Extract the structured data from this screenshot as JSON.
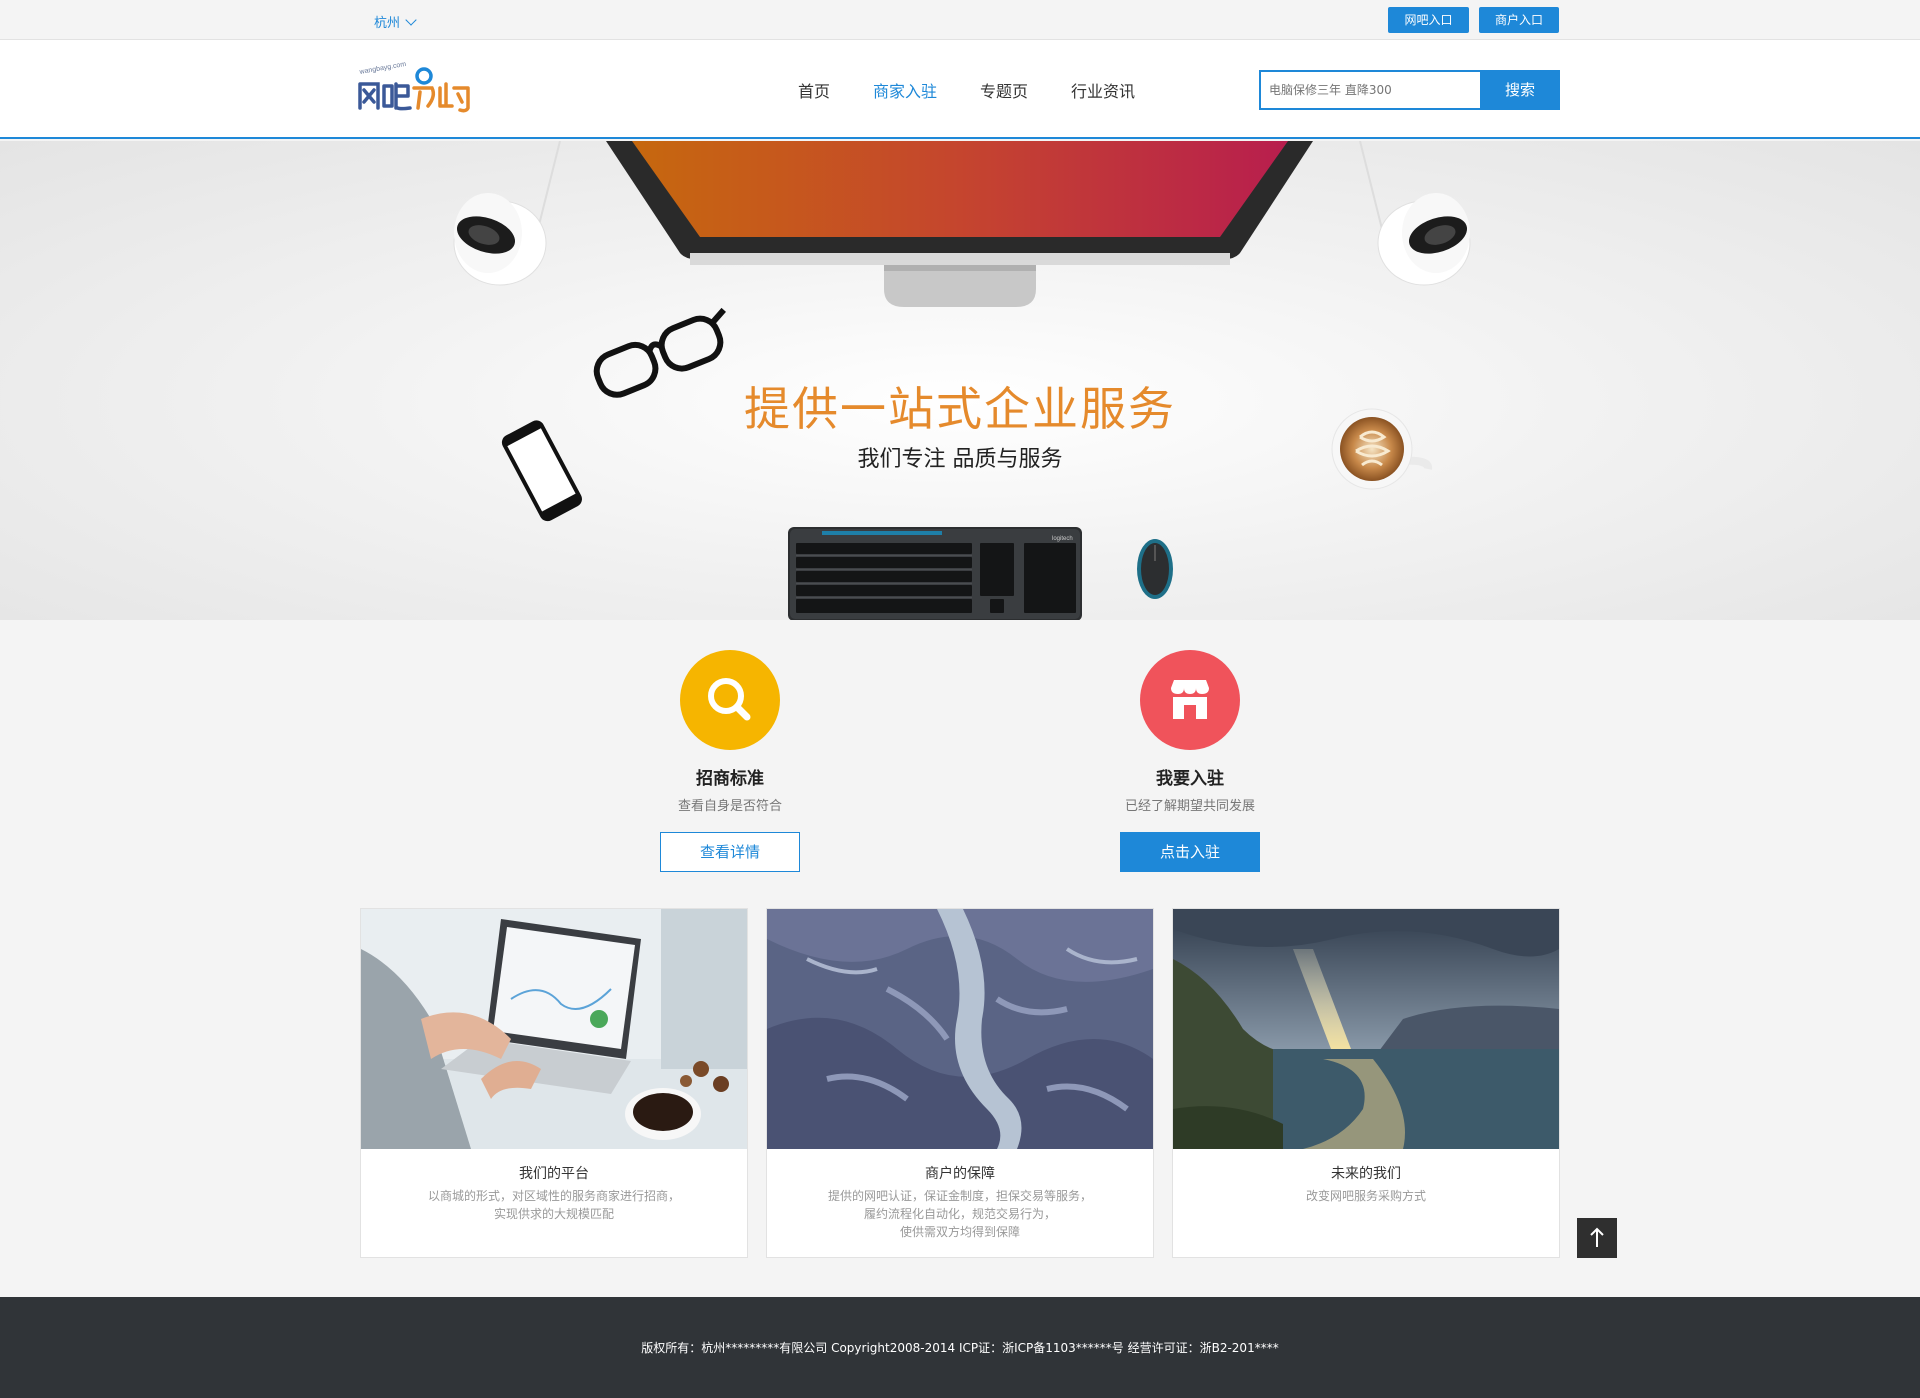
{
  "topbar": {
    "city": "杭州",
    "entries": [
      "网吧入口",
      "商户入口"
    ]
  },
  "header": {
    "logo_text": "网吧易购",
    "logo_domain": "wangbayg.com",
    "nav": [
      "首页",
      "商家入驻",
      "专题页",
      "行业资讯"
    ],
    "nav_active": "商家入驻",
    "search": {
      "placeholder": "电脑保修三年 直降300",
      "button": "搜索"
    }
  },
  "banner": {
    "title": "提供一站式企业服务",
    "subtitle": "我们专注 品质与服务",
    "keyboard_brand": "logitech"
  },
  "features": [
    {
      "icon": "search-icon",
      "color": "#f6b500",
      "title": "招商标准",
      "desc": "查看自身是否符合",
      "button": "查看详情"
    },
    {
      "icon": "store-icon",
      "color": "#f0535b",
      "title": "我要入驻",
      "desc": "已经了解期望共同发展",
      "button": "点击入驻"
    }
  ],
  "cards": [
    {
      "title": "我们的平台",
      "desc": [
        "以商城的形式，对区域性的服务商家进行招商，",
        "实现供求的大规模匹配"
      ]
    },
    {
      "title": "商户的保障",
      "desc": [
        "提供的网吧认证，保证金制度，担保交易等服务，",
        "履约流程化自动化，规范交易行为，",
        "使供需双方均得到保障"
      ]
    },
    {
      "title": "未来的我们",
      "desc": [
        "改变网吧服务采购方式"
      ]
    }
  ],
  "footer": {
    "text": "版权所有：杭州*********有限公司 Copyright2008-2014 ICP证：浙ICP备1103******号 经营许可证：浙B2-201****"
  },
  "colors": {
    "accent": "#1e88d8",
    "banner_title": "#e58a2c",
    "footer_bg": "#303438"
  }
}
